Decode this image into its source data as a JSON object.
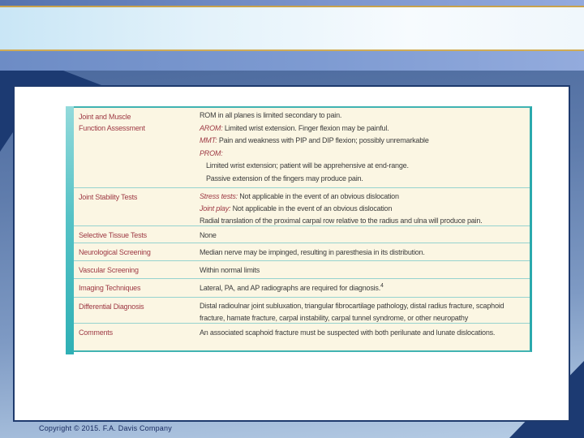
{
  "slide": {
    "copyright": "Copyright ©  2015. F.A. Davis Company"
  },
  "colors": {
    "accent_teal": "#2fb0b5",
    "separator_teal": "#96d3cf",
    "table_background": "#fbf6e3",
    "category_red": "#9e3944",
    "body_text": "#3c3c3c",
    "navy": "#1c3a72",
    "gold": "#c9a24b"
  },
  "table": {
    "rows": [
      {
        "category": "Joint and Muscle\nFunction Assessment",
        "lines": [
          {
            "lead": "",
            "text": "ROM in all planes is limited secondary to pain.",
            "indent": false
          },
          {
            "lead": "AROM:",
            "text": "Limited wrist extension. Finger flexion may be painful.",
            "indent": false
          },
          {
            "lead": "MMT:",
            "text": "Pain and weakness with PIP and DIP flexion; possibly unremarkable",
            "indent": false
          },
          {
            "lead": "PROM:",
            "text": "",
            "indent": false
          },
          {
            "lead": "",
            "text": "Limited wrist extension; patient will be apprehensive at end-range.",
            "indent": true
          },
          {
            "lead": "",
            "text": "Passive extension of the fingers may produce pain.",
            "indent": true
          }
        ]
      },
      {
        "category": "Joint Stability Tests",
        "lines": [
          {
            "lead": "Stress tests:",
            "text": "Not applicable in the event of an obvious dislocation",
            "indent": false
          },
          {
            "lead": "Joint play:",
            "text": "Not applicable in the event of an obvious dislocation",
            "indent": false
          },
          {
            "lead": "",
            "text": "Radial translation of the proximal carpal row relative to the radius and ulna will produce pain.",
            "indent": false
          }
        ]
      },
      {
        "category": "Selective Tissue Tests",
        "lines": [
          {
            "lead": "",
            "text": "None",
            "indent": false
          }
        ]
      },
      {
        "category": "Neurological Screening",
        "lines": [
          {
            "lead": "",
            "text": "Median nerve may be impinged, resulting in paresthesia in its distribution.",
            "indent": false
          }
        ]
      },
      {
        "category": "Vascular Screening",
        "lines": [
          {
            "lead": "",
            "text": "Within normal limits",
            "indent": false
          }
        ]
      },
      {
        "category": "Imaging Techniques",
        "lines": [
          {
            "lead": "",
            "text": "Lateral, PA, and AP radiographs are required for diagnosis.",
            "sup": "4",
            "indent": false
          }
        ]
      },
      {
        "category": "Differential Diagnosis",
        "lines": [
          {
            "lead": "",
            "text": "Distal radioulnar joint subluxation, triangular fibrocartilage pathology, distal radius fracture, scaphoid fracture, hamate fracture, carpal instability, carpal tunnel syndrome, or other neuropathy",
            "indent": false
          }
        ]
      },
      {
        "category": "Comments",
        "lines": [
          {
            "lead": "",
            "text": "An associated scaphoid fracture must be suspected with both perilunate and lunate dislocations.",
            "indent": false
          }
        ]
      }
    ]
  }
}
